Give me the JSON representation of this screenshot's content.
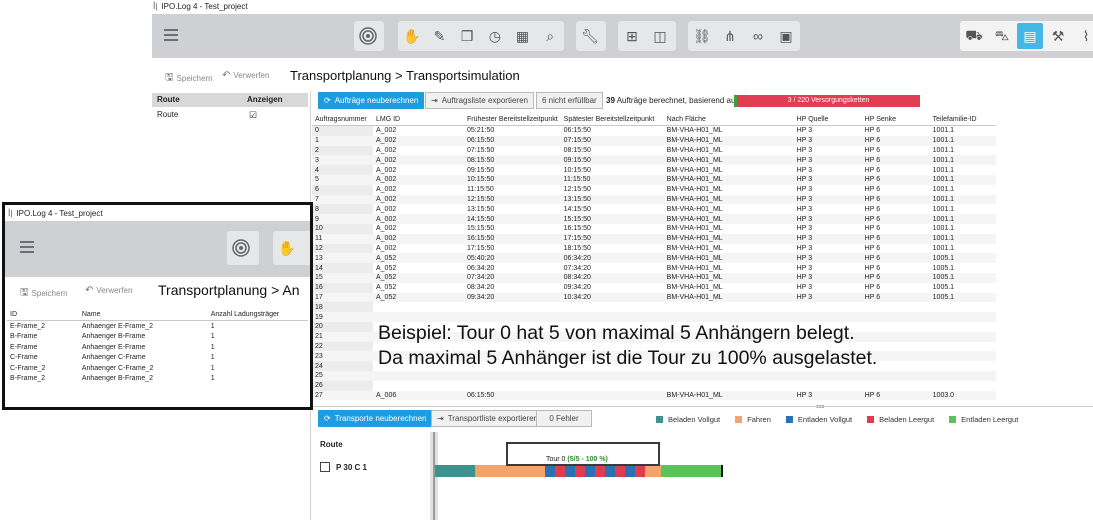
{
  "window": {
    "title": "IPO.Log 4 - Test_project"
  },
  "toolbar": {
    "groups": [
      [
        "target-icon"
      ],
      [
        "hand-icon",
        "pencil-icon",
        "copy-icon",
        "clock-icon",
        "grid-icon",
        "search-icon"
      ],
      [
        "wrench-icon"
      ],
      [
        "cross-grid-icon",
        "area-icon"
      ],
      [
        "link-icon",
        "network-icon",
        "chain-icon",
        "matrix-icon"
      ],
      [
        "truck-icon",
        "trailer-icon",
        "calendar-icon",
        "forklift-icon",
        "stairs-icon"
      ],
      [
        "frame-icon"
      ]
    ]
  },
  "actions": {
    "save": "Speichern",
    "discard": "Verwerfen"
  },
  "breadcrumb": {
    "first": "Transportplanung",
    "sep": ">",
    "second": "Transportsimulation"
  },
  "route_panel": {
    "headers": [
      "Route",
      "Anzeigen"
    ],
    "rows": [
      {
        "route": "Route",
        "show": "☑"
      }
    ]
  },
  "orders_bar": {
    "recalc": "Aufträge neuberechnen",
    "export": "Auftragsliste exportieren",
    "unfulfilled": "6 nicht erfüllbar",
    "count": "39",
    "status_text": "Aufträge berechnet, basierend auf:",
    "progress_label": "3 / 220 Versorgungsketten",
    "progress_fraction": 0.0136
  },
  "orders_table": {
    "headers": [
      "Auftragsnummer",
      "LMG ID",
      "Frühester Bereitstellzeitpunkt",
      "Spätester Bereitstellzeitpunkt",
      "Nach Fläche",
      "HP Quelle",
      "HP Senke",
      "Teilefamilie-ID"
    ],
    "rows": [
      [
        "0",
        "A_002",
        "05:21:50",
        "06:15:50",
        "BM-VHA-H01_ML",
        "HP 3",
        "HP 6",
        "1001.1"
      ],
      [
        "1",
        "A_002",
        "06:15:50",
        "07:15:50",
        "BM-VHA-H01_ML",
        "HP 3",
        "HP 6",
        "1001.1"
      ],
      [
        "2",
        "A_002",
        "07:15:50",
        "08:15:50",
        "BM-VHA-H01_ML",
        "HP 3",
        "HP 6",
        "1001.1"
      ],
      [
        "3",
        "A_002",
        "08:15:50",
        "09:15:50",
        "BM-VHA-H01_ML",
        "HP 3",
        "HP 6",
        "1001.1"
      ],
      [
        "4",
        "A_002",
        "09:15:50",
        "10:15:50",
        "BM-VHA-H01_ML",
        "HP 3",
        "HP 6",
        "1001.1"
      ],
      [
        "5",
        "A_002",
        "10:15:50",
        "11:15:50",
        "BM-VHA-H01_ML",
        "HP 3",
        "HP 6",
        "1001.1"
      ],
      [
        "6",
        "A_002",
        "11:15:50",
        "12:15:50",
        "BM-VHA-H01_ML",
        "HP 3",
        "HP 6",
        "1001.1"
      ],
      [
        "7",
        "A_002",
        "12:15:50",
        "13:15:50",
        "BM-VHA-H01_ML",
        "HP 3",
        "HP 6",
        "1001.1"
      ],
      [
        "8",
        "A_002",
        "13:15:50",
        "14:15:50",
        "BM-VHA-H01_ML",
        "HP 3",
        "HP 6",
        "1001.1"
      ],
      [
        "9",
        "A_002",
        "14:15:50",
        "15:15:50",
        "BM-VHA-H01_ML",
        "HP 3",
        "HP 6",
        "1001.1"
      ],
      [
        "10",
        "A_002",
        "15:15:50",
        "16:15:50",
        "BM-VHA-H01_ML",
        "HP 3",
        "HP 6",
        "1001.1"
      ],
      [
        "11",
        "A_002",
        "16:15:50",
        "17:15:50",
        "BM-VHA-H01_ML",
        "HP 3",
        "HP 6",
        "1001.1"
      ],
      [
        "12",
        "A_002",
        "17:15:50",
        "18:15:50",
        "BM-VHA-H01_ML",
        "HP 3",
        "HP 6",
        "1001.1"
      ],
      [
        "13",
        "A_052",
        "05:40:20",
        "06:34:20",
        "BM-VHA-H01_ML",
        "HP 3",
        "HP 6",
        "1005.1"
      ],
      [
        "14",
        "A_052",
        "06:34:20",
        "07:34:20",
        "BM-VHA-H01_ML",
        "HP 3",
        "HP 6",
        "1005.1"
      ],
      [
        "15",
        "A_052",
        "07:34:20",
        "08:34:20",
        "BM-VHA-H01_ML",
        "HP 3",
        "HP 6",
        "1005.1"
      ],
      [
        "16",
        "A_052",
        "08:34:20",
        "09:34:20",
        "BM-VHA-H01_ML",
        "HP 3",
        "HP 6",
        "1005.1"
      ],
      [
        "17",
        "A_052",
        "09:34:20",
        "10:34:20",
        "BM-VHA-H01_ML",
        "HP 3",
        "HP 6",
        "1005.1"
      ],
      [
        "18",
        "",
        "",
        "",
        "",
        "",
        "",
        ""
      ],
      [
        "19",
        "",
        "",
        "",
        "",
        "",
        "",
        ""
      ],
      [
        "20",
        "",
        "",
        "",
        "",
        "",
        "",
        ""
      ],
      [
        "21",
        "",
        "",
        "",
        "",
        "",
        "",
        ""
      ],
      [
        "22",
        "",
        "",
        "",
        "",
        "",
        "",
        ""
      ],
      [
        "23",
        "",
        "",
        "",
        "",
        "",
        "",
        ""
      ],
      [
        "24",
        "",
        "",
        "",
        "",
        "",
        "",
        ""
      ],
      [
        "25",
        "",
        "",
        "",
        "",
        "",
        "",
        ""
      ],
      [
        "26",
        "",
        "",
        "",
        "",
        "",
        "",
        ""
      ],
      [
        "27",
        "A_006",
        "06:15:50",
        "",
        "BM-VHA-H01_ML",
        "HP 3",
        "HP 6",
        "1003.0"
      ]
    ]
  },
  "annotation": {
    "line1": "Beispiel: Tour 0 hat 5 von maximal 5 Anhängern belegt.",
    "line2": "Da maximal 5 Anhänger ist die Tour zu 100% ausgelastet."
  },
  "transport_bar": {
    "recalc": "Transporte neuberechnen",
    "export": "Transportliste exportieren",
    "errors": "0 Fehler"
  },
  "legend": [
    {
      "label": "Beladen Vollgut",
      "color": "#3d9290"
    },
    {
      "label": "Fahren",
      "color": "#f2a46c"
    },
    {
      "label": "Entladen Vollgut",
      "color": "#2b6fb4"
    },
    {
      "label": "Beladen Leergut",
      "color": "#dc3c4c"
    },
    {
      "label": "Entladen Leergut",
      "color": "#5cc25a"
    }
  ],
  "gantt": {
    "route_header": "Route",
    "route_name": "P 30 C 1",
    "tour_label": "Tour 0",
    "tour_util": "(5/5 - 100 %)",
    "util_color": "#2e8f2e"
  },
  "inset": {
    "title": "IPO.Log 4 - Test_project",
    "save": "Speichern",
    "discard": "Verwerfen",
    "breadcrumb": "Transportplanung",
    "breadcrumb_tail": "> An",
    "headers": [
      "ID",
      "Name",
      "Anzahl Ladungsträger"
    ],
    "rows": [
      [
        "E-Frame_2",
        "Anhaenger E-Frame_2",
        "1"
      ],
      [
        "B-Frame",
        "Anhaenger B-Frame",
        "1"
      ],
      [
        "E-Frame",
        "Anhaenger E-Frame",
        "1"
      ],
      [
        "C-Frame",
        "Anhaenger C-Frame",
        "1"
      ],
      [
        "C-Frame_2",
        "Anhaenger C-Frame_2",
        "1"
      ],
      [
        "B-Frame_2",
        "Anhaenger B-Frame_2",
        "1"
      ]
    ]
  }
}
